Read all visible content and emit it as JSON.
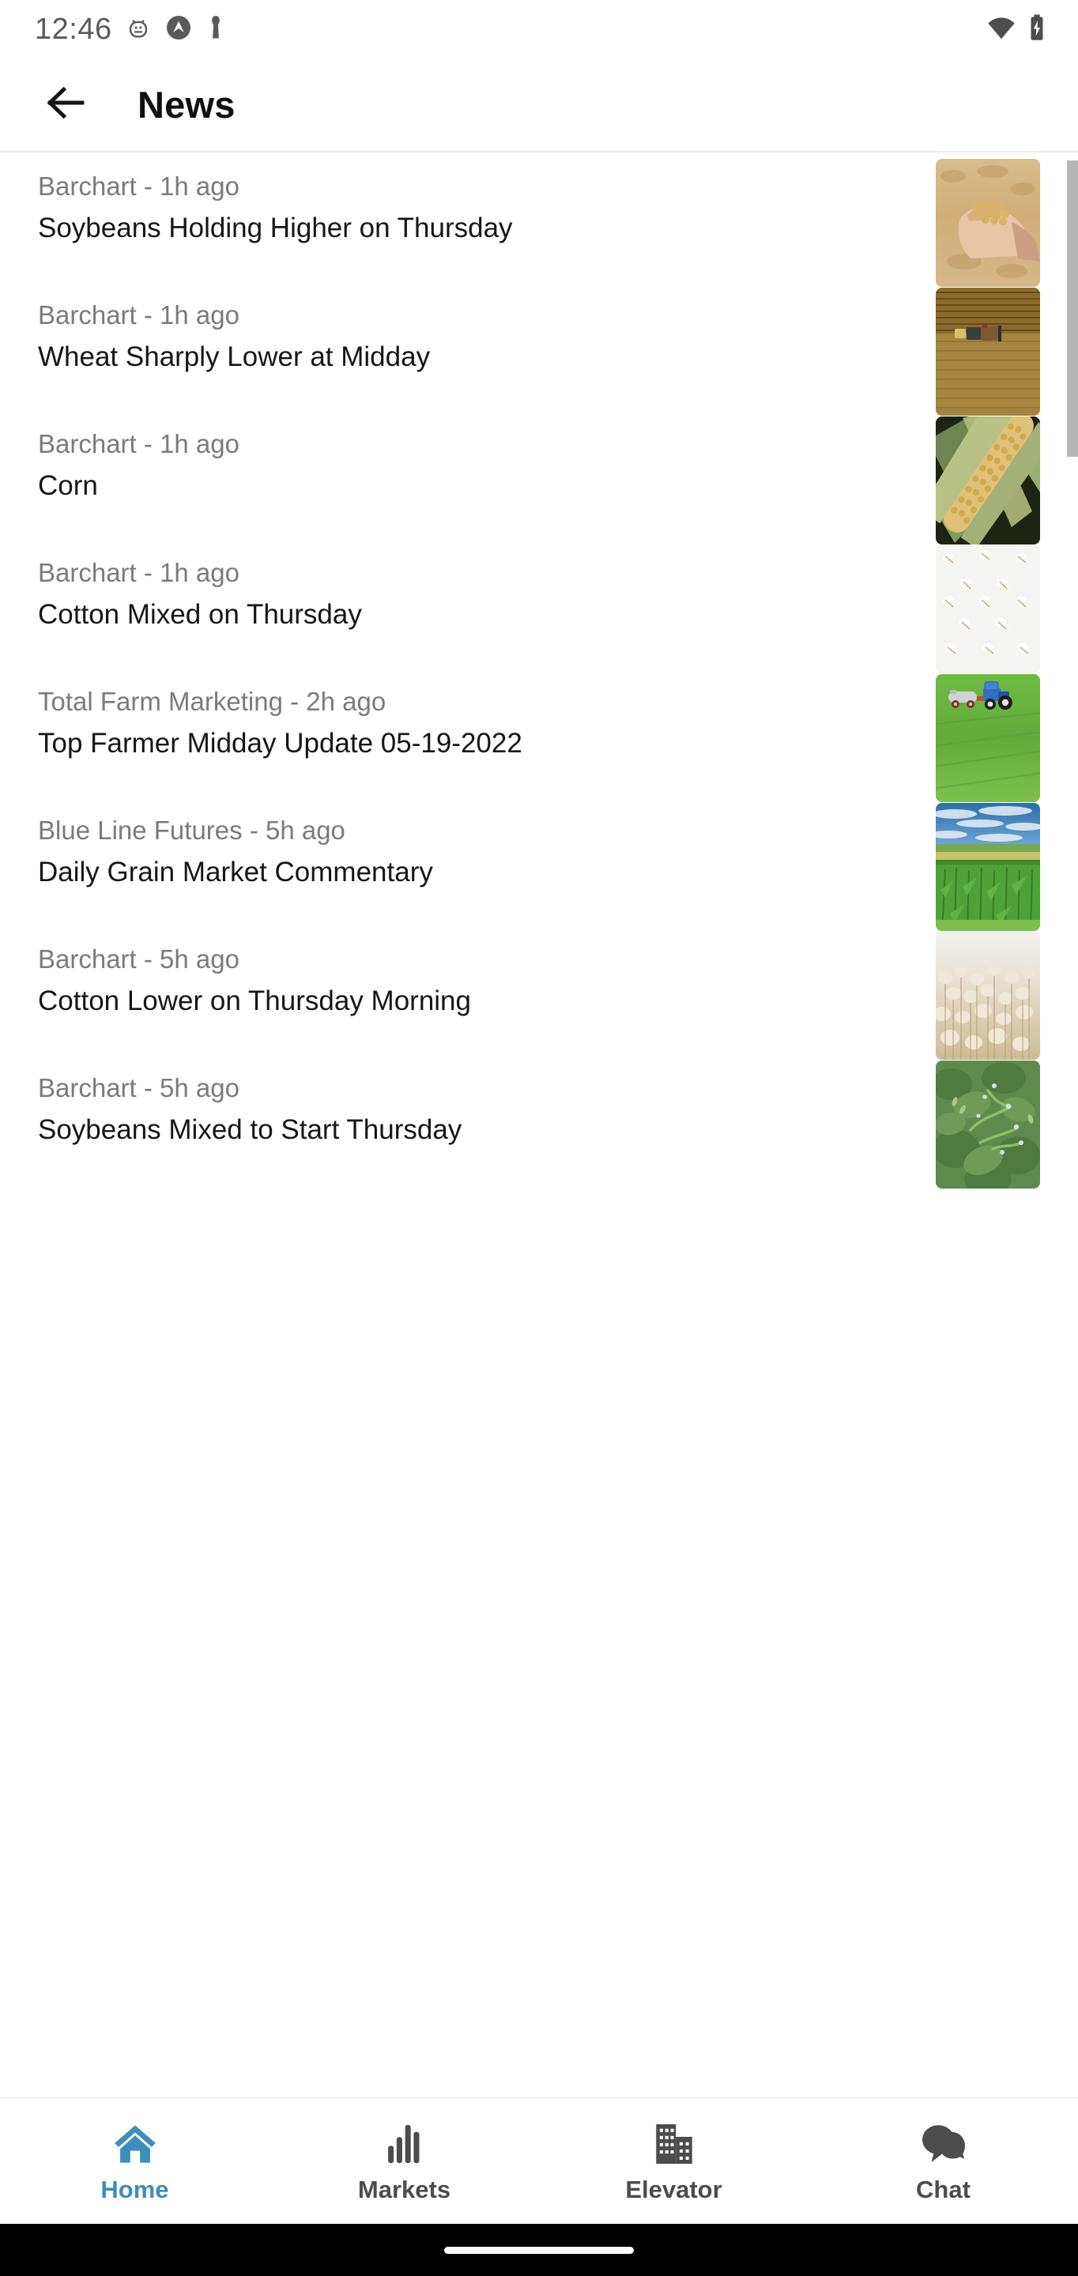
{
  "status_bar": {
    "time": "12:46",
    "left_icons": [
      "android-debug-icon",
      "circle-arrow-up-icon",
      "person-icon"
    ],
    "right_icons": [
      "wifi-icon",
      "battery-charging-icon"
    ]
  },
  "app_bar": {
    "back_icon": "back-arrow-icon",
    "title": "News"
  },
  "news": {
    "items": [
      {
        "source": "Barchart - 1h ago",
        "title": "Soybeans Holding Higher on Thursday",
        "thumbnail": "hands-holding-soybeans-photo"
      },
      {
        "source": "Barchart - 1h ago",
        "title": "Wheat Sharply Lower at Midday",
        "thumbnail": "aerial-combine-wheat-field-photo"
      },
      {
        "source": "Barchart - 1h ago",
        "title": "Corn",
        "thumbnail": "corn-cob-husk-photo"
      },
      {
        "source": "Barchart - 1h ago",
        "title": "Cotton Mixed on Thursday",
        "thumbnail": "cotton-bolls-white-background-photo"
      },
      {
        "source": "Total Farm Marketing - 2h ago",
        "title": "Top Farmer Midday Update 05-19-2022",
        "thumbnail": "blue-tractor-green-field-photo"
      },
      {
        "source": "Blue Line Futures - 5h ago",
        "title": "Daily Grain Market Commentary",
        "thumbnail": "corn-field-blue-sky-photo"
      },
      {
        "source": "Barchart - 5h ago",
        "title": "Cotton Lower on Thursday Morning",
        "thumbnail": "cotton-field-photo"
      },
      {
        "source": "Barchart - 5h ago",
        "title": "Soybeans Mixed to Start Thursday",
        "thumbnail": "soybean-plant-flowers-photo"
      }
    ]
  },
  "bottom_nav": {
    "active_index": 0,
    "active_color": "#3d8dbd",
    "inactive_color": "#4c4c4c",
    "items": [
      {
        "label": "Home",
        "icon": "home-icon"
      },
      {
        "label": "Markets",
        "icon": "bar-chart-icon"
      },
      {
        "label": "Elevator",
        "icon": "buildings-icon"
      },
      {
        "label": "Chat",
        "icon": "chat-bubbles-icon"
      }
    ]
  }
}
